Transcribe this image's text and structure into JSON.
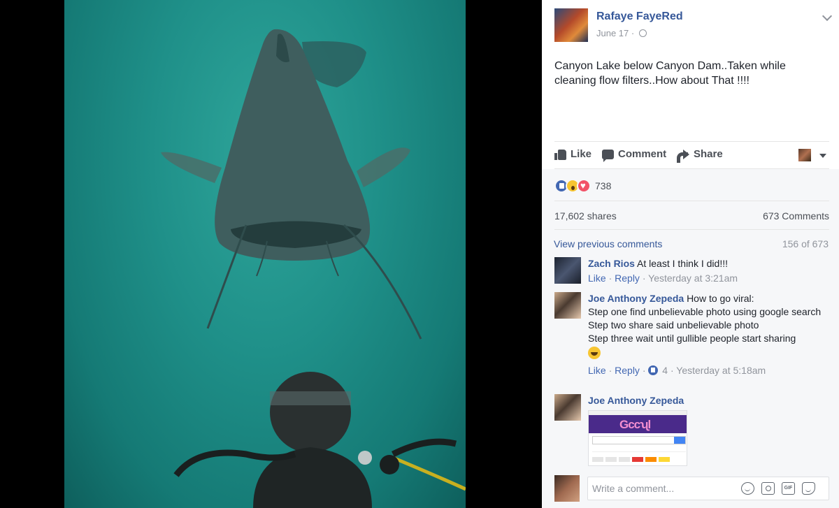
{
  "post": {
    "author": "Rafaye FayeRed",
    "date": "June 17",
    "date_separator": "·",
    "text": "Canyon Lake below Canyon Dam..Taken while cleaning flow filters..How about That !!!!"
  },
  "actions": {
    "like": "Like",
    "comment": "Comment",
    "share": "Share"
  },
  "feedback": {
    "reaction_count": "738",
    "shares": "17,602 shares",
    "comments": "673 Comments",
    "view_previous": "View previous comments",
    "pager": "156 of 673"
  },
  "comments": [
    {
      "name": "Zach Rios",
      "text": "At least I think I did!!!",
      "like": "Like",
      "reply": "Reply",
      "time": "Yesterday at 3:21am",
      "sep": "·"
    },
    {
      "name": "Joe Anthony Zepeda",
      "lines": [
        "How to go viral:",
        "Step one find unbelievable photo using google search",
        "Step two share said unbelievable photo",
        "Step three wait until gullible people start sharing"
      ],
      "like": "Like",
      "reply": "Reply",
      "likes": "4",
      "time": "Yesterday at 5:18am",
      "sep": "·"
    },
    {
      "name": "Joe Anthony Zepeda"
    }
  ],
  "composer": {
    "placeholder": "Write a comment...",
    "gif": "GIF"
  },
  "colors": {
    "link": "#365899",
    "meta": "#90949c",
    "water": "#1f9089"
  }
}
